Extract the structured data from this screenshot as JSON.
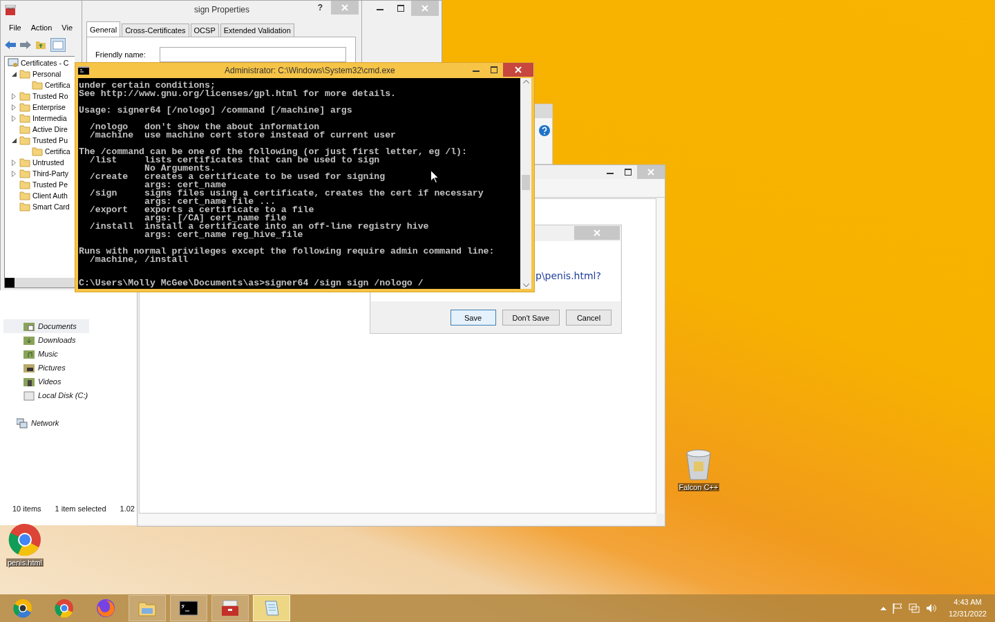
{
  "mmc": {
    "menu": [
      "File",
      "Action",
      "Vie"
    ],
    "tree_root": "Certificates - C",
    "tree": [
      {
        "label": "Personal",
        "expanded": true,
        "children": [
          {
            "label": "Certifica"
          }
        ]
      },
      {
        "label": "Trusted Ro",
        "expanded": false
      },
      {
        "label": "Enterprise",
        "expanded": false
      },
      {
        "label": "Intermedia",
        "expanded": false
      },
      {
        "label": "Active Dire"
      },
      {
        "label": "Trusted Pu",
        "expanded": true,
        "children": [
          {
            "label": "Certifica"
          }
        ]
      },
      {
        "label": "Untrusted",
        "expanded": false
      },
      {
        "label": "Third-Party",
        "expanded": false
      },
      {
        "label": "Trusted Pe"
      },
      {
        "label": "Client Auth"
      },
      {
        "label": "Smart Card"
      }
    ]
  },
  "properties": {
    "title": "sign Properties",
    "help": "?",
    "tabs": [
      {
        "label": "General",
        "selected": true
      },
      {
        "label": "Cross-Certificates",
        "selected": false
      },
      {
        "label": "OCSP",
        "selected": false
      },
      {
        "label": "Extended Validation",
        "selected": false
      }
    ],
    "friendly_name_label": "Friendly name:"
  },
  "cmd": {
    "title": "Administrator: C:\\Windows\\System32\\cmd.exe",
    "blocks": [
      [
        "under certain conditions;",
        "See http://www.gnu.org/licenses/gpl.html for more details."
      ],
      [
        "Usage: signer64 [/nologo] /command [/machine] args"
      ],
      [
        "  /nologo   don't show the about information",
        "  /machine  use machine cert store instead of current user"
      ],
      [
        "The /command can be one of the following (or just first letter, eg /l):",
        "  /list     lists certificates that can be used to sign",
        "            No Arguments.",
        "  /create   creates a certificate to be used for signing",
        "            args: cert_name",
        "  /sign     signs files using a certificate, creates the cert if necessary",
        "            args: cert_name file ...",
        "  /export   exports a certificate to a file",
        "            args: [/CA] cert_name file",
        "  /install  install a certificate into an off-line registry hive",
        "            args: cert_name reg_hive_file"
      ],
      [
        "Runs with normal privileges except the following require admin command line:",
        "  /machine, /install"
      ]
    ],
    "prompt": "C:\\Users\\Molly McGee\\Documents\\as>signer64 /sign sign /nologo /"
  },
  "explorer": {
    "nav": [
      {
        "label": "Documents",
        "kind": "documents",
        "selected": true
      },
      {
        "label": "Downloads",
        "kind": "downloads",
        "selected": false
      },
      {
        "label": "Music",
        "kind": "music",
        "selected": false
      },
      {
        "label": "Pictures",
        "kind": "pictures",
        "selected": false
      },
      {
        "label": "Videos",
        "kind": "videos",
        "selected": false
      },
      {
        "label": "Local Disk (C:)",
        "kind": "disk",
        "selected": false
      },
      {
        "label": "Network",
        "kind": "network",
        "selected": false
      }
    ],
    "status": [
      "10 items",
      "1 item selected",
      "1.02"
    ]
  },
  "save_dialog": {
    "message": "p\\penis.html?",
    "buttons": [
      {
        "label": "Save",
        "default": true
      },
      {
        "label": "Don't Save",
        "default": false
      },
      {
        "label": "Cancel",
        "default": false
      }
    ]
  },
  "desktop_icons": [
    {
      "label": "Falcon C++",
      "kind": "recycle-bin"
    },
    {
      "label": "penis.html",
      "kind": "browser"
    }
  ],
  "taskbar": {
    "apps": [
      {
        "kind": "canary",
        "running": false,
        "selected": false
      },
      {
        "kind": "chrome",
        "running": false,
        "selected": false
      },
      {
        "kind": "firefox",
        "running": false,
        "selected": false
      },
      {
        "kind": "folder",
        "running": true,
        "selected": false
      },
      {
        "kind": "console",
        "running": true,
        "selected": false
      },
      {
        "kind": "toolbox",
        "running": true,
        "selected": false
      },
      {
        "kind": "notepad",
        "running": true,
        "selected": true
      }
    ],
    "time": "4:43 AM",
    "date": "12/31/2022"
  }
}
